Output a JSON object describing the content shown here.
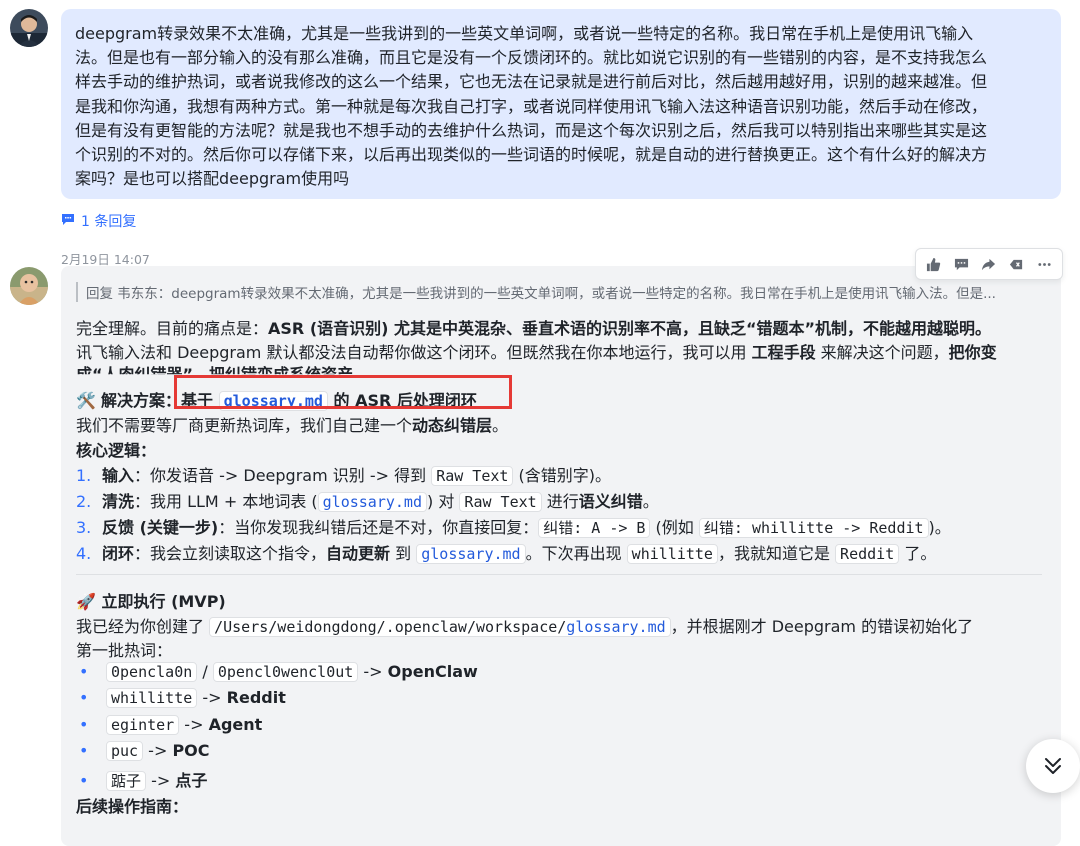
{
  "message1": {
    "text_lines": [
      "deepgram转录效果不太准确，尤其是一些我讲到的一些英文单词啊，或者说一些特定的名称。我日常在手机上是使用讯飞输入",
      "法。但是也有一部分输入的没有那么准确，而且它是没有一个反馈闭环的。就比如说它识别的有一些错别的内容，是不支持我怎么",
      "样去手动的维护热词，或者说我修改的这么一个结果，它也无法在记录就是进行前后对比，然后越用越好用，识别的越来越准。但",
      "是我和你沟通，我想有两种方式。第一种就是每次我自己打字，或者说同样使用讯飞输入法这种语音识别功能，然后手动在修改，",
      "但是有没有更智能的方法呢？就是我也不想手动的去维护什么热词，而是这个每次识别之后，然后我可以特别指出来哪些其实是这",
      "个识别的不对的。然后你可以存储下来，以后再出现类似的一些词语的时候呢，就是自动的进行替换更正。这个有什么好的解决方",
      "案吗？是也可以搭配deepgram使用吗"
    ],
    "reply_count_label": "1 条回复"
  },
  "message2": {
    "timestamp": "2月19日 14:07",
    "quote": "回复 韦东东：deepgram转录效果不太准确，尤其是一些我讲到的一些英文单词啊，或者说一些特定的名称。我日常在手机上是使用讯飞输入法。但是...",
    "intro": {
      "p1a": "完全理解。目前的痛点是：",
      "p1b": "ASR (语音识别) 尤其是中英混杂、垂直术语的识别率不高，且缺乏“错题本”机制，不能越用越聪明。",
      "p2a": "讯飞输入法和 Deepgram 默认都没法自动帮你做这个闭环。但既然我在你本地运行，我可以用 ",
      "p2b": "工程手段",
      "p2c": " 来解决这个问题，",
      "p2d": "把你变",
      "p3": "成“人肉纠错器”，把纠错变成系统资产。"
    },
    "solution": {
      "icon": "🛠️",
      "label": "解决方案：",
      "pre": "基于 ",
      "code": "glossary.md",
      "post": " 的 ASR 后处理闭环",
      "line2a": "我们不需要等厂商更新热词库，我们自己建一个",
      "line2b": "动态纠错层",
      "line2c": "。"
    },
    "core_logic_title": "核心逻辑：",
    "steps": [
      {
        "num": "1.",
        "title": "输入",
        "t1": "：你发语音 -> Deepgram 识别 -> 得到 ",
        "c1": "Raw Text",
        "t2": " (含错别字)。"
      },
      {
        "num": "2.",
        "title": "清洗",
        "t1": "：我用 LLM + 本地词表 (",
        "c1": "glossary.md",
        "t2": ") 对 ",
        "c2": "Raw Text",
        "t3": " 进行",
        "b1": "语义纠错",
        "t4": "。"
      },
      {
        "num": "3.",
        "title": "反馈 (关键一步)",
        "t1": "：当你发现我纠错后还是不对，你直接回复：",
        "c1": "纠错: A -> B",
        "t2": " (例如 ",
        "c2": "纠错: whillitte -> Reddit",
        "t3": ")。"
      },
      {
        "num": "4.",
        "title": "闭环",
        "t1": "：我会立刻读取这个指令，",
        "b1": "自动更新",
        "t2": " 到 ",
        "c1": "glossary.md",
        "t3": "。下次再出现 ",
        "c2": "whillitte",
        "t4": "，我就知道它是 ",
        "c3": "Reddit",
        "t5": " 了。"
      }
    ],
    "mvp": {
      "icon": "🚀",
      "title": "立即执行 (MVP)",
      "line1a": "我已经为你创建了 ",
      "path_prefix": "/Users/weidongdong/.openclaw/workspace/",
      "path_file": "glossary.md",
      "line1b": "，并根据刚才 Deepgram 的错误初始化了",
      "line2": "第一批热词：",
      "bullet": "•",
      "items": [
        {
          "wrong": "0pencla0n",
          "sep": " / ",
          "wrong2": "0pencl0wencl0ut",
          "arrow": " -> ",
          "right": "OpenClaw"
        },
        {
          "wrong": "whillitte",
          "arrow": " -> ",
          "right": "Reddit"
        },
        {
          "wrong": "eginter",
          "arrow": " -> ",
          "right": "Agent"
        },
        {
          "wrong": "puc",
          "arrow": " -> ",
          "right": "POC"
        },
        {
          "wrong": "踮子",
          "arrow": " -> ",
          "right": "点子"
        }
      ],
      "guide_title": "后续操作指南："
    }
  },
  "colors": {
    "bubble": "#e1eaff",
    "card": "#f2f3f5",
    "accent": "#3370ff",
    "highlight": "#e53935"
  },
  "icons": [
    "thumbs-up-icon",
    "comment-icon",
    "forward-icon",
    "pin-icon",
    "more-icon",
    "chevron-double-down-icon"
  ]
}
